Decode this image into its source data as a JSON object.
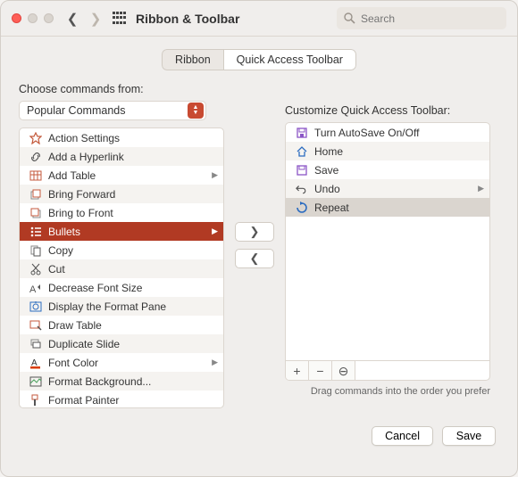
{
  "window": {
    "title": "Ribbon & Toolbar",
    "search_placeholder": "Search"
  },
  "tabs": {
    "ribbon": "Ribbon",
    "qat": "Quick Access Toolbar"
  },
  "choose_label": "Choose commands from:",
  "choose_source": "Popular Commands",
  "commands": [
    {
      "icon": "action",
      "label": "Action Settings",
      "expand": false
    },
    {
      "icon": "link",
      "label": "Add a Hyperlink",
      "expand": false
    },
    {
      "icon": "table",
      "label": "Add Table",
      "expand": true
    },
    {
      "icon": "forward",
      "label": "Bring Forward",
      "expand": false
    },
    {
      "icon": "front",
      "label": "Bring to Front",
      "expand": false
    },
    {
      "icon": "bullets",
      "label": "Bullets",
      "expand": true
    },
    {
      "icon": "copy",
      "label": "Copy",
      "expand": false
    },
    {
      "icon": "cut",
      "label": "Cut",
      "expand": false
    },
    {
      "icon": "decfont",
      "label": "Decrease Font Size",
      "expand": false
    },
    {
      "icon": "format",
      "label": "Display the Format Pane",
      "expand": false
    },
    {
      "icon": "draw",
      "label": "Draw Table",
      "expand": false
    },
    {
      "icon": "dup",
      "label": "Duplicate Slide",
      "expand": false
    },
    {
      "icon": "color",
      "label": "Font Color",
      "expand": true
    },
    {
      "icon": "bkg",
      "label": "Format Background...",
      "expand": false
    },
    {
      "icon": "painter",
      "label": "Format Painter",
      "expand": false
    }
  ],
  "customize_label": "Customize Quick Access Toolbar:",
  "qat_items": [
    {
      "icon": "save",
      "label": "Turn AutoSave On/Off",
      "expand": false
    },
    {
      "icon": "home",
      "label": "Home",
      "expand": false
    },
    {
      "icon": "save2",
      "label": "Save",
      "expand": false
    },
    {
      "icon": "undo",
      "label": "Undo",
      "expand": true
    },
    {
      "icon": "repeat",
      "label": "Repeat",
      "expand": false
    }
  ],
  "hint": "Drag commands into the order you prefer",
  "buttons": {
    "cancel": "Cancel",
    "save": "Save"
  },
  "colors": {
    "accent": "#b13a23",
    "icon": "#c45a3c",
    "blue": "#2c6cc0",
    "purple": "#8b55c6"
  }
}
